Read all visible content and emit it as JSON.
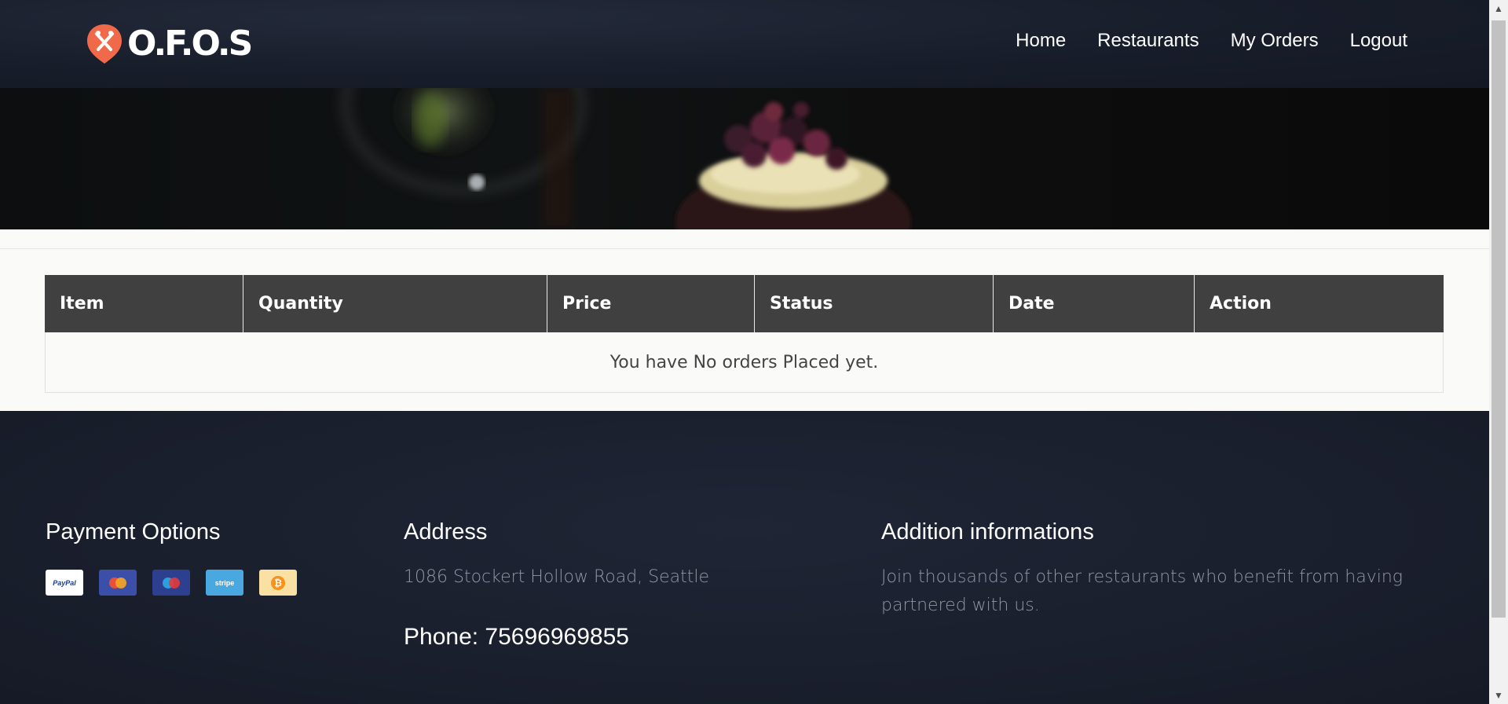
{
  "header": {
    "logo_text": "O.F.O.S",
    "nav": [
      {
        "label": "Home"
      },
      {
        "label": "Restaurants"
      },
      {
        "label": "My Orders"
      },
      {
        "label": "Logout"
      }
    ]
  },
  "orders": {
    "columns": [
      "Item",
      "Quantity",
      "Price",
      "Status",
      "Date",
      "Action"
    ],
    "empty_message": "You have No orders Placed yet."
  },
  "footer": {
    "payment": {
      "title": "Payment Options",
      "methods": [
        {
          "name": "PayPal",
          "icon": "paypal-icon",
          "label": "PayPal"
        },
        {
          "name": "Mastercard",
          "icon": "mastercard-icon",
          "label": ""
        },
        {
          "name": "Maestro",
          "icon": "maestro-icon",
          "label": ""
        },
        {
          "name": "Stripe",
          "icon": "stripe-icon",
          "label": "stripe"
        },
        {
          "name": "Bitcoin",
          "icon": "bitcoin-icon",
          "label": "₿"
        }
      ]
    },
    "address": {
      "title": "Address",
      "line": "1086 Stockert Hollow Road, Seattle",
      "phone": "Phone: 75696969855"
    },
    "additional": {
      "title": "Addition informations",
      "text": "Join thousands of other restaurants who benefit from having partnered with us."
    }
  },
  "colors": {
    "header_bg": "#181d2a",
    "logo_accent": "#f06a4a",
    "table_header_bg": "#404040",
    "footer_bg": "#1a1f2d",
    "footer_text": "#9097a6"
  }
}
